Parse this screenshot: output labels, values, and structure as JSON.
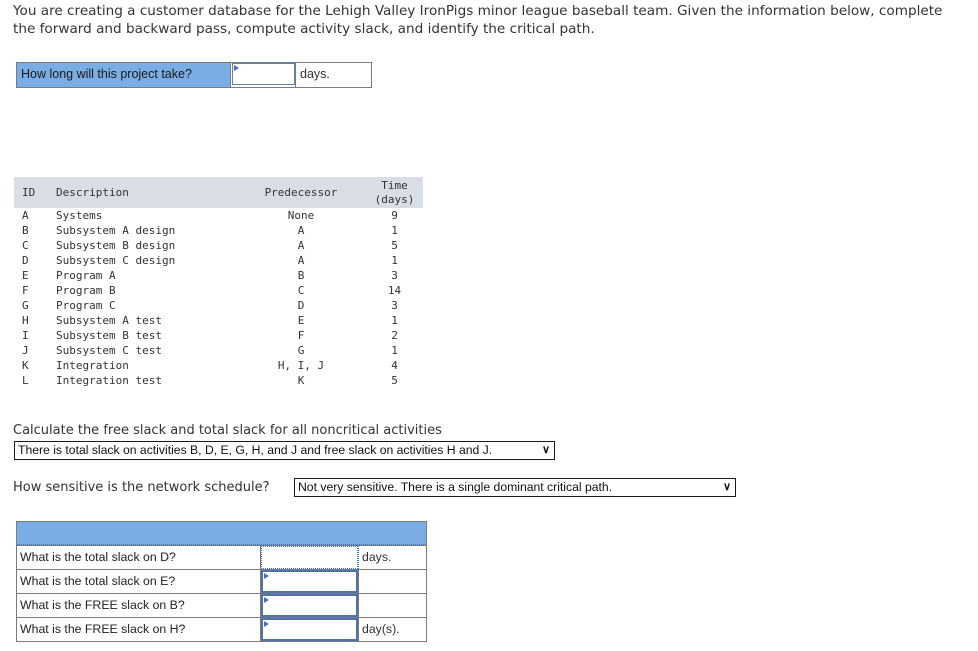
{
  "intro_text": "You are creating a customer database for the Lehigh Valley IronPigs minor league baseball team. Given the information below, complete the forward and backward pass, compute activity slack, and identify the critical path.",
  "question1": {
    "label": "How long will this project take?",
    "value": "",
    "unit": "days."
  },
  "activity_table": {
    "headers": {
      "id": "ID",
      "description": "Description",
      "predecessor": "Predecessor",
      "time_line1": "Time",
      "time_line2": "(days)"
    },
    "rows": [
      {
        "id": "A",
        "description": "Systems",
        "predecessor": "None",
        "time": "9"
      },
      {
        "id": "B",
        "description": "Subsystem A design",
        "predecessor": "A",
        "time": "1"
      },
      {
        "id": "C",
        "description": "Subsystem B design",
        "predecessor": "A",
        "time": "5"
      },
      {
        "id": "D",
        "description": "Subsystem C design",
        "predecessor": "A",
        "time": "1"
      },
      {
        "id": "E",
        "description": "Program A",
        "predecessor": "B",
        "time": "3"
      },
      {
        "id": "F",
        "description": "Program B",
        "predecessor": "C",
        "time": "14"
      },
      {
        "id": "G",
        "description": "Program C",
        "predecessor": "D",
        "time": "3"
      },
      {
        "id": "H",
        "description": "Subsystem A test",
        "predecessor": "E",
        "time": "1"
      },
      {
        "id": "I",
        "description": "Subsystem B test",
        "predecessor": "F",
        "time": "2"
      },
      {
        "id": "J",
        "description": "Subsystem C test",
        "predecessor": "G",
        "time": "1"
      },
      {
        "id": "K",
        "description": "Integration",
        "predecessor": "H, I, J",
        "time": "4"
      },
      {
        "id": "L",
        "description": "Integration test",
        "predecessor": "K",
        "time": "5"
      }
    ]
  },
  "question2": {
    "label": "Calculate the free slack and total slack for all noncritical activities",
    "selected": "There is total slack on activities B, D, E, G, H, and J and free slack on activities H and J."
  },
  "question3": {
    "label": "How sensitive is the network schedule?",
    "selected": "Not very sensitive. There is a single dominant critical path."
  },
  "slack_questions": [
    {
      "question": "What is the total slack on D?",
      "value": "",
      "unit": "days."
    },
    {
      "question": "What is the total slack on E?",
      "value": "",
      "unit": ""
    },
    {
      "question": "What is the FREE slack on B?",
      "value": "",
      "unit": ""
    },
    {
      "question": "What is the FREE slack on H?",
      "value": "",
      "unit": "day(s)."
    }
  ]
}
